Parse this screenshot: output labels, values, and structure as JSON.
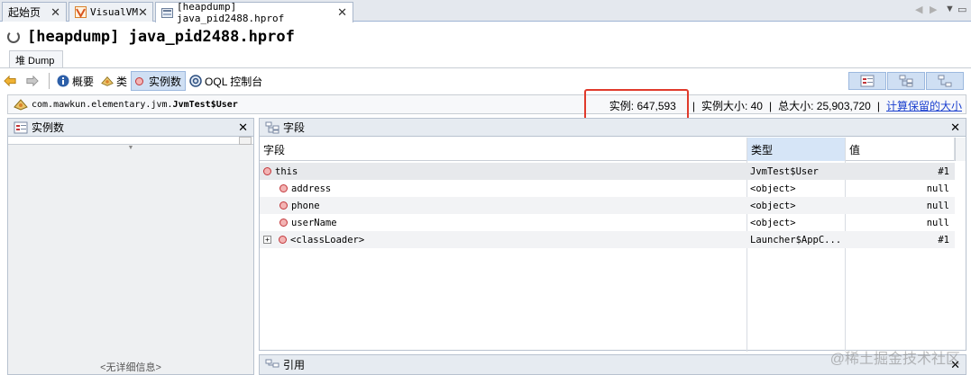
{
  "tabs": [
    {
      "label": "起始页",
      "close": "✕",
      "active": false,
      "icon": ""
    },
    {
      "label": "VisualVM",
      "close": "✕",
      "active": false,
      "icon": "visualvm-icon"
    },
    {
      "label": "[heapdump] java_pid2488.hprof",
      "close": "✕",
      "active": true,
      "icon": "heapdump-icon"
    }
  ],
  "tab_controls": {
    "prev": "◀",
    "next": "▶",
    "menu": "▼",
    "restore": "▭"
  },
  "page": {
    "title": "[heapdump] java_pid2488.hprof"
  },
  "subtab": {
    "label": "堆 Dump"
  },
  "toolbar": {
    "summary": "概要",
    "classes": "类",
    "instances": "实例数",
    "oql": "OQL 控制台"
  },
  "class_bar": {
    "package": "com.mawkun.elementary.jvm.",
    "classname": "JvmTest$User",
    "instances_text": "实例: 647,593",
    "instance_size_text": "实例大小: 40",
    "total_size_text": "总大小: 25,903,720",
    "compute_link": "计算保留的大小",
    "sep": "|"
  },
  "left_panel": {
    "title": "实例数",
    "close": "✕",
    "no_detail": "<无详细信息>"
  },
  "right_panel": {
    "title": "字段",
    "close": "✕",
    "columns": {
      "field": "字段",
      "type": "类型",
      "value": "值"
    },
    "rows": [
      {
        "field": "this",
        "type": "JvmTest$User",
        "value": "#1"
      },
      {
        "field": "address",
        "type": "<object>",
        "value": "null"
      },
      {
        "field": "phone",
        "type": "<object>",
        "value": "null"
      },
      {
        "field": "userName",
        "type": "<object>",
        "value": "null"
      },
      {
        "field": "<classLoader>",
        "type": "Launcher$AppC...",
        "value": "#1"
      }
    ]
  },
  "ref_panel": {
    "title": "引用",
    "close": "✕"
  },
  "watermark": "@稀土掘金技术社区",
  "colors": {
    "highlight": "#e03a2b",
    "selected_bg": "#cfdff3",
    "link": "#1a3fcf"
  }
}
